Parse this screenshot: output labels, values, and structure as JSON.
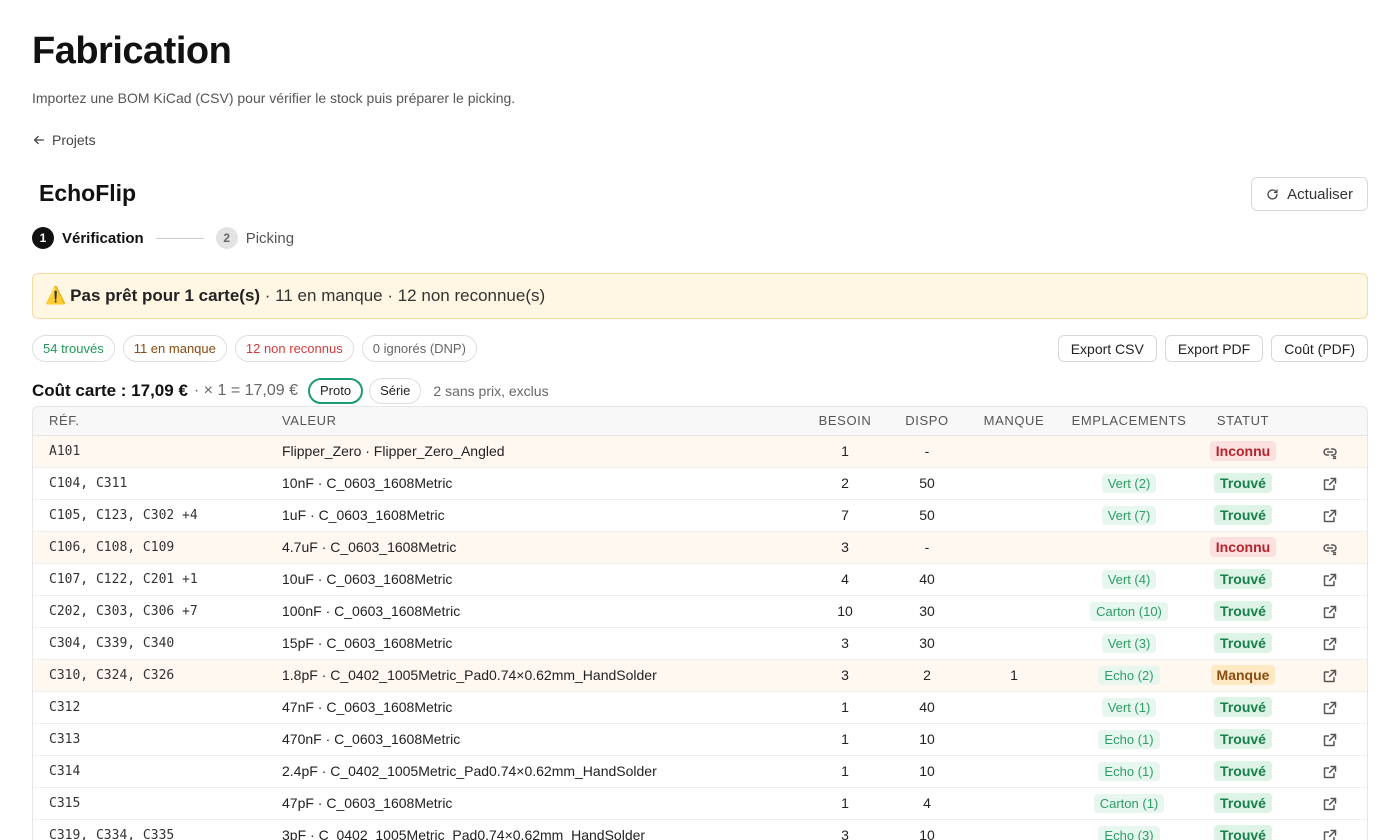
{
  "header": {
    "title": "Fabrication",
    "subtitle": "Importez une BOM KiCad (CSV) pour vérifier le stock puis préparer le picking."
  },
  "nav": {
    "back_label": "Projets"
  },
  "project": {
    "name": "EchoFlip",
    "refresh_label": "Actualiser"
  },
  "stepper": [
    {
      "num": "1",
      "label": "Vérification",
      "active": true
    },
    {
      "num": "2",
      "label": "Picking",
      "active": false
    }
  ],
  "alert": {
    "bold": "Pas prêt pour 1 carte(s)",
    "rest": " · 11 en manque · 12 non reconnue(s)"
  },
  "filters": {
    "found": "54 trouvés",
    "missing": "11 en manque",
    "unknown": "12 non reconnus",
    "ignored": "0 ignorés (DNP)"
  },
  "exports": {
    "csv": "Export CSV",
    "pdf": "Export PDF",
    "cost": "Coût (PDF)"
  },
  "cost": {
    "label": "Coût carte : 17,09 €",
    "multiplier": "· × 1 = 17,09 €",
    "mode_proto": "Proto",
    "mode_serie": "Série",
    "note": "2 sans prix, exclus"
  },
  "table": {
    "columns": {
      "ref": "RÉF.",
      "value": "VALEUR",
      "need": "BESOIN",
      "avail": "DISPO",
      "missing": "MANQUE",
      "locations": "EMPLACEMENTS",
      "status": "STATUT"
    },
    "rows": [
      {
        "ref": "A101",
        "value": "Flipper_Zero · Flipper_Zero_Angled",
        "need": "1",
        "avail": "-",
        "missing": "",
        "location": "",
        "status": "Inconnu",
        "action": "link-icon"
      },
      {
        "ref": "C104, C311",
        "value": "10nF · C_0603_1608Metric",
        "need": "2",
        "avail": "50",
        "missing": "",
        "location": "Vert (2)",
        "status": "Trouvé",
        "action": "external-link-icon"
      },
      {
        "ref": "C105, C123, C302 +4",
        "value": "1uF · C_0603_1608Metric",
        "need": "7",
        "avail": "50",
        "missing": "",
        "location": "Vert (7)",
        "status": "Trouvé",
        "action": "external-link-icon"
      },
      {
        "ref": "C106, C108, C109",
        "value": "4.7uF · C_0603_1608Metric",
        "need": "3",
        "avail": "-",
        "missing": "",
        "location": "",
        "status": "Inconnu",
        "action": "link-icon"
      },
      {
        "ref": "C107, C122, C201 +1",
        "value": "10uF · C_0603_1608Metric",
        "need": "4",
        "avail": "40",
        "missing": "",
        "location": "Vert (4)",
        "status": "Trouvé",
        "action": "external-link-icon"
      },
      {
        "ref": "C202, C303, C306 +7",
        "value": "100nF · C_0603_1608Metric",
        "need": "10",
        "avail": "30",
        "missing": "",
        "location": "Carton (10)",
        "status": "Trouvé",
        "action": "external-link-icon"
      },
      {
        "ref": "C304, C339, C340",
        "value": "15pF · C_0603_1608Metric",
        "need": "3",
        "avail": "30",
        "missing": "",
        "location": "Vert (3)",
        "status": "Trouvé",
        "action": "external-link-icon"
      },
      {
        "ref": "C310, C324, C326",
        "value": "1.8pF · C_0402_1005Metric_Pad0.74×0.62mm_HandSolder",
        "need": "3",
        "avail": "2",
        "missing": "1",
        "location": "Echo (2)",
        "status": "Manque",
        "action": "external-link-icon"
      },
      {
        "ref": "C312",
        "value": "47nF · C_0603_1608Metric",
        "need": "1",
        "avail": "40",
        "missing": "",
        "location": "Vert (1)",
        "status": "Trouvé",
        "action": "external-link-icon"
      },
      {
        "ref": "C313",
        "value": "470nF · C_0603_1608Metric",
        "need": "1",
        "avail": "10",
        "missing": "",
        "location": "Echo (1)",
        "status": "Trouvé",
        "action": "external-link-icon"
      },
      {
        "ref": "C314",
        "value": "2.4pF · C_0402_1005Metric_Pad0.74×0.62mm_HandSolder",
        "need": "1",
        "avail": "10",
        "missing": "",
        "location": "Echo (1)",
        "status": "Trouvé",
        "action": "external-link-icon"
      },
      {
        "ref": "C315",
        "value": "47pF · C_0603_1608Metric",
        "need": "1",
        "avail": "4",
        "missing": "",
        "location": "Carton (1)",
        "status": "Trouvé",
        "action": "external-link-icon"
      },
      {
        "ref": "C319, C334, C335",
        "value": "3pF · C_0402_1005Metric_Pad0.74×0.62mm_HandSolder",
        "need": "3",
        "avail": "10",
        "missing": "",
        "location": "Echo (3)",
        "status": "Trouvé",
        "action": "external-link-icon"
      }
    ]
  }
}
